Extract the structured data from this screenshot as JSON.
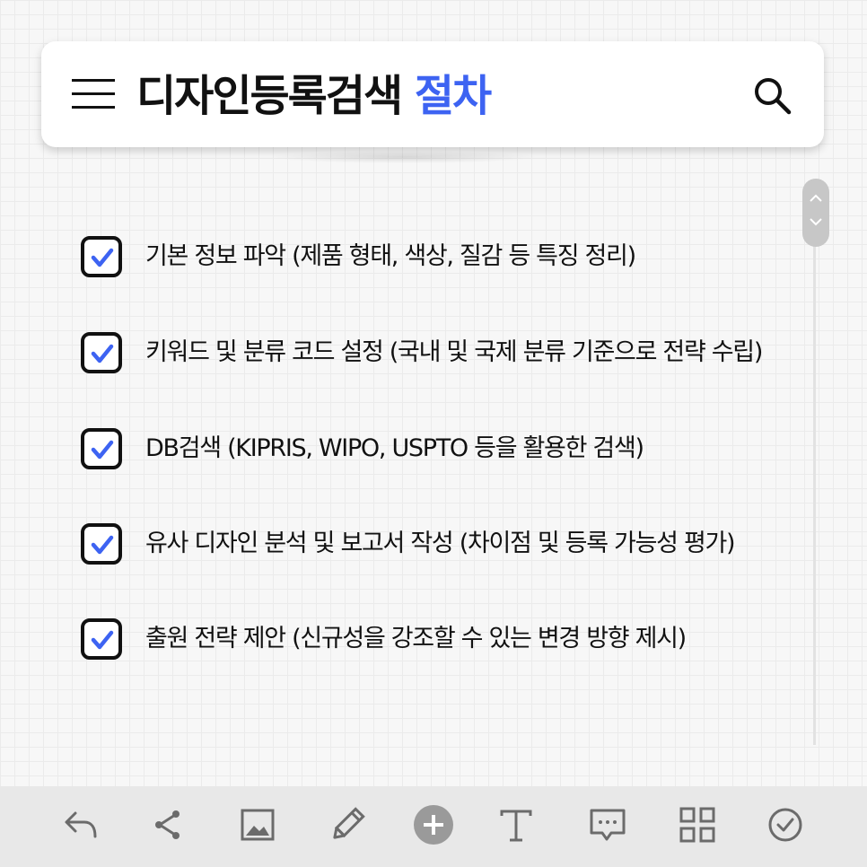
{
  "header": {
    "title_main": "디자인등록검색",
    "title_accent": "절차",
    "menu_icon": "hamburger-icon",
    "search_icon": "search-icon"
  },
  "checklist": [
    {
      "label": "기본 정보 파악 (제품 형태, 색상, 질감 등 특징 정리)",
      "checked": true
    },
    {
      "label": "키워드 및 분류 코드 설정 (국내 및 국제 분류 기준으로 전략 수립)",
      "checked": true
    },
    {
      "label": "DB검색 (KIPRIS, WIPO, USPTO 등을 활용한 검색)",
      "checked": true
    },
    {
      "label": "유사 디자인 분석 및 보고서 작성 (차이점 및 등록 가능성 평가)",
      "checked": true
    },
    {
      "label": "출원 전략 제안 (신규성을 강조할 수 있는 변경 방향 제시)",
      "checked": true
    }
  ],
  "toolbar": {
    "items": [
      "undo-icon",
      "share-icon",
      "image-icon",
      "pencil-icon",
      "add-icon",
      "text-icon",
      "comment-icon",
      "grid-icon",
      "check-circle-icon"
    ]
  },
  "colors": {
    "accent": "#3d63f2",
    "text": "#111111",
    "toolbar_bg": "#e8e8e8",
    "toolbar_icon": "#6b6b6b"
  }
}
